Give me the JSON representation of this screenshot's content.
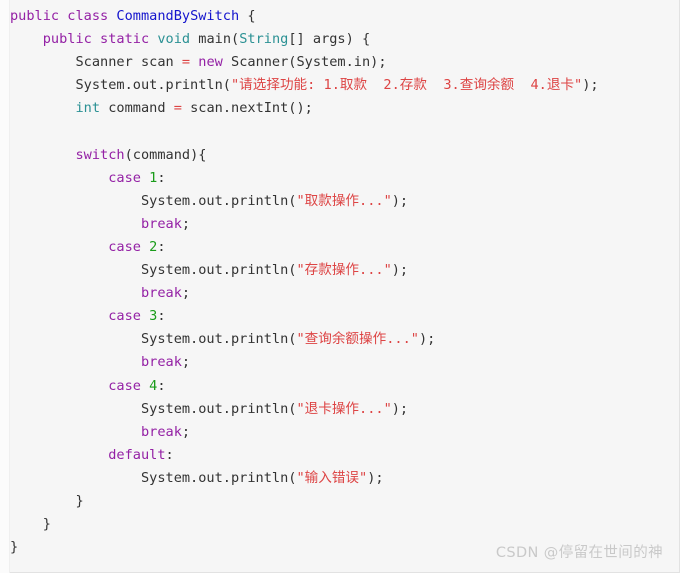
{
  "editor": {
    "language": "java",
    "background_color": "#f6f6f6",
    "default_text_color": "#333333",
    "token_colors": {
      "keyword": "#9421a5",
      "type": "#2b9194",
      "class_name": "#1414cd",
      "string": "#dd4444",
      "number": "#1a9c1a",
      "plain": "#333333"
    }
  },
  "code": {
    "lines": [
      {
        "number": 1,
        "indent": 0,
        "tokens": [
          {
            "t": "public",
            "c": "kw"
          },
          {
            "t": " ",
            "c": "pln"
          },
          {
            "t": "class",
            "c": "kw"
          },
          {
            "t": " ",
            "c": "pln"
          },
          {
            "t": "CommandBySwitch",
            "c": "cls"
          },
          {
            "t": " {",
            "c": "pln"
          }
        ]
      },
      {
        "number": 2,
        "indent": 1,
        "tokens": [
          {
            "t": "public",
            "c": "kw"
          },
          {
            "t": " ",
            "c": "pln"
          },
          {
            "t": "static",
            "c": "kw"
          },
          {
            "t": " ",
            "c": "pln"
          },
          {
            "t": "void",
            "c": "typ"
          },
          {
            "t": " ",
            "c": "pln"
          },
          {
            "t": "main",
            "c": "pln"
          },
          {
            "t": "(",
            "c": "pln"
          },
          {
            "t": "String",
            "c": "typ"
          },
          {
            "t": "[] args) {",
            "c": "pln"
          }
        ]
      },
      {
        "number": 3,
        "indent": 2,
        "tokens": [
          {
            "t": "Scanner scan ",
            "c": "pln"
          },
          {
            "t": "=",
            "c": "str"
          },
          {
            "t": " ",
            "c": "pln"
          },
          {
            "t": "new",
            "c": "kw"
          },
          {
            "t": " Scanner(System.in);",
            "c": "pln"
          }
        ]
      },
      {
        "number": 4,
        "indent": 2,
        "tokens": [
          {
            "t": "System.out.println(",
            "c": "pln"
          },
          {
            "t": "\"请选择功能: 1.取款  2.存款  3.查询余额  4.退卡\"",
            "c": "str"
          },
          {
            "t": ");",
            "c": "pln"
          }
        ]
      },
      {
        "number": 5,
        "indent": 2,
        "tokens": [
          {
            "t": "int",
            "c": "typ"
          },
          {
            "t": " command ",
            "c": "pln"
          },
          {
            "t": "=",
            "c": "str"
          },
          {
            "t": " scan.nextInt();",
            "c": "pln"
          }
        ]
      },
      {
        "number": 6,
        "indent": 0,
        "tokens": []
      },
      {
        "number": 7,
        "indent": 2,
        "tokens": [
          {
            "t": "switch",
            "c": "kw"
          },
          {
            "t": "(command){",
            "c": "pln"
          }
        ]
      },
      {
        "number": 8,
        "indent": 3,
        "tokens": [
          {
            "t": "case",
            "c": "kw"
          },
          {
            "t": " ",
            "c": "pln"
          },
          {
            "t": "1",
            "c": "num"
          },
          {
            "t": ":",
            "c": "pln"
          }
        ]
      },
      {
        "number": 9,
        "indent": 4,
        "tokens": [
          {
            "t": "System.out.println(",
            "c": "pln"
          },
          {
            "t": "\"取款操作...\"",
            "c": "str"
          },
          {
            "t": ");",
            "c": "pln"
          }
        ]
      },
      {
        "number": 10,
        "indent": 4,
        "tokens": [
          {
            "t": "break",
            "c": "kw"
          },
          {
            "t": ";",
            "c": "pln"
          }
        ]
      },
      {
        "number": 11,
        "indent": 3,
        "tokens": [
          {
            "t": "case",
            "c": "kw"
          },
          {
            "t": " ",
            "c": "pln"
          },
          {
            "t": "2",
            "c": "num"
          },
          {
            "t": ":",
            "c": "pln"
          }
        ]
      },
      {
        "number": 12,
        "indent": 4,
        "tokens": [
          {
            "t": "System.out.println(",
            "c": "pln"
          },
          {
            "t": "\"存款操作...\"",
            "c": "str"
          },
          {
            "t": ");",
            "c": "pln"
          }
        ]
      },
      {
        "number": 13,
        "indent": 4,
        "tokens": [
          {
            "t": "break",
            "c": "kw"
          },
          {
            "t": ";",
            "c": "pln"
          }
        ]
      },
      {
        "number": 14,
        "indent": 3,
        "tokens": [
          {
            "t": "case",
            "c": "kw"
          },
          {
            "t": " ",
            "c": "pln"
          },
          {
            "t": "3",
            "c": "num"
          },
          {
            "t": ":",
            "c": "pln"
          }
        ]
      },
      {
        "number": 15,
        "indent": 4,
        "tokens": [
          {
            "t": "System.out.println(",
            "c": "pln"
          },
          {
            "t": "\"查询余额操作...\"",
            "c": "str"
          },
          {
            "t": ");",
            "c": "pln"
          }
        ]
      },
      {
        "number": 16,
        "indent": 4,
        "tokens": [
          {
            "t": "break",
            "c": "kw"
          },
          {
            "t": ";",
            "c": "pln"
          }
        ]
      },
      {
        "number": 17,
        "indent": 3,
        "tokens": [
          {
            "t": "case",
            "c": "kw"
          },
          {
            "t": " ",
            "c": "pln"
          },
          {
            "t": "4",
            "c": "num"
          },
          {
            "t": ":",
            "c": "pln"
          }
        ]
      },
      {
        "number": 18,
        "indent": 4,
        "tokens": [
          {
            "t": "System.out.println(",
            "c": "pln"
          },
          {
            "t": "\"退卡操作...\"",
            "c": "str"
          },
          {
            "t": ");",
            "c": "pln"
          }
        ]
      },
      {
        "number": 19,
        "indent": 4,
        "tokens": [
          {
            "t": "break",
            "c": "kw"
          },
          {
            "t": ";",
            "c": "pln"
          }
        ]
      },
      {
        "number": 20,
        "indent": 3,
        "tokens": [
          {
            "t": "default",
            "c": "kw"
          },
          {
            "t": ":",
            "c": "pln"
          }
        ]
      },
      {
        "number": 21,
        "indent": 4,
        "tokens": [
          {
            "t": "System.out.println(",
            "c": "pln"
          },
          {
            "t": "\"输入错误\"",
            "c": "str"
          },
          {
            "t": ");",
            "c": "pln"
          }
        ]
      },
      {
        "number": 22,
        "indent": 2,
        "tokens": [
          {
            "t": "}",
            "c": "pln"
          }
        ]
      },
      {
        "number": 23,
        "indent": 1,
        "tokens": [
          {
            "t": "}",
            "c": "pln"
          }
        ]
      },
      {
        "number": 24,
        "indent": 0,
        "tokens": [
          {
            "t": "}",
            "c": "pln"
          }
        ]
      }
    ]
  },
  "watermark": {
    "text": "CSDN @停留在世间的神",
    "color": "#c9c9c9"
  }
}
